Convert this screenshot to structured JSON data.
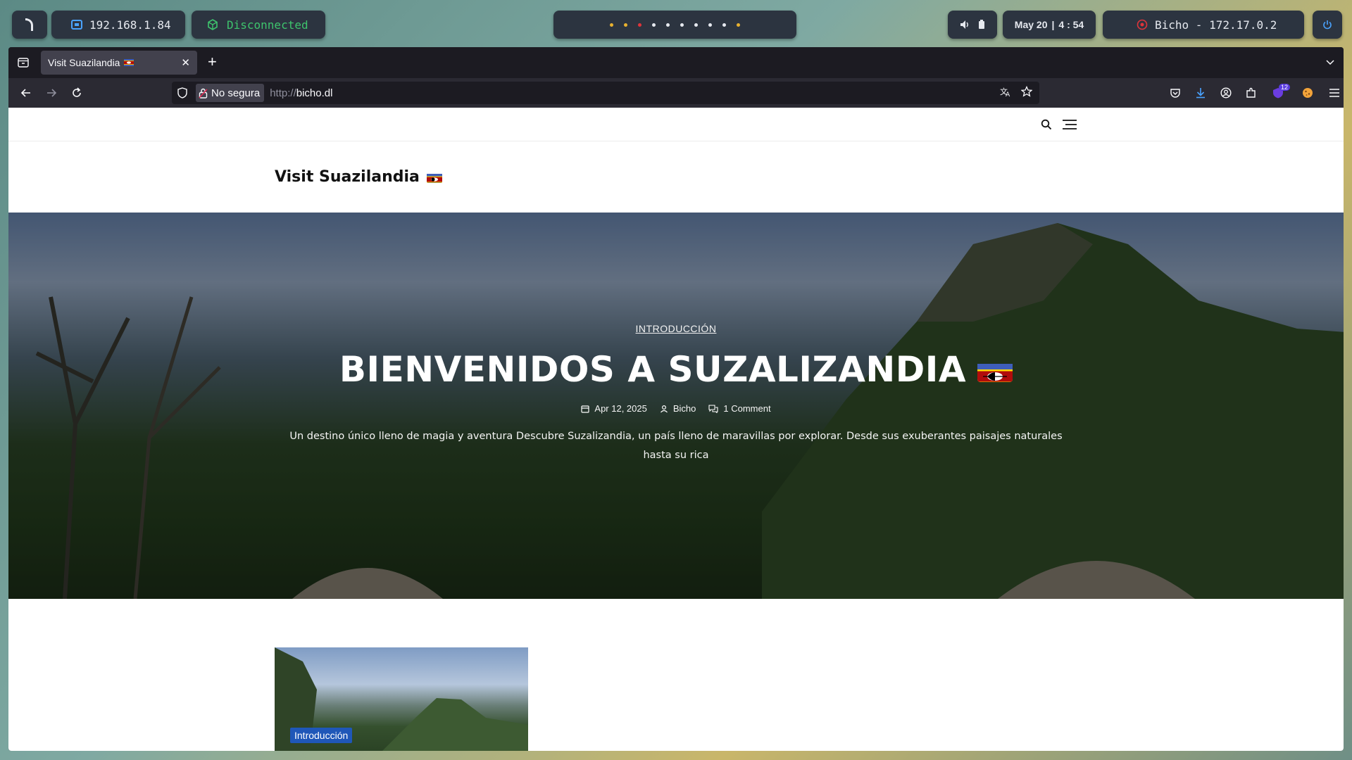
{
  "system_bar": {
    "ip": "192.168.1.84",
    "vpn_status": "Disconnected",
    "workspace_count": 10,
    "date": "May 20",
    "separator": "|",
    "time": "4 : 54",
    "target": "Bicho - 172.17.0.2",
    "colors": {
      "vpn": "#3ec46d",
      "target_icon": "#e0343a",
      "power": "#4aa3ff"
    }
  },
  "browser": {
    "tab_title": "Visit Suazilandia",
    "insecure_label": "No segura",
    "url_protocol": "http://",
    "url_host": "bicho.dl",
    "extension_badge": "12"
  },
  "site": {
    "brand": "Visit Suazilandia",
    "hero": {
      "category": "INTRODUCCIÓN",
      "title": "BIENVENIDOS A SUZALIZANDIA",
      "date": "Apr 12, 2025",
      "author": "Bicho",
      "comments": "1 Comment",
      "excerpt": "Un destino único lleno de magia y aventura Descubre Suzalizandia, un país lleno de maravillas por explorar. Desde sus exuberantes paisajes naturales hasta su rica"
    },
    "post_card": {
      "category_label": "Introducción"
    }
  }
}
